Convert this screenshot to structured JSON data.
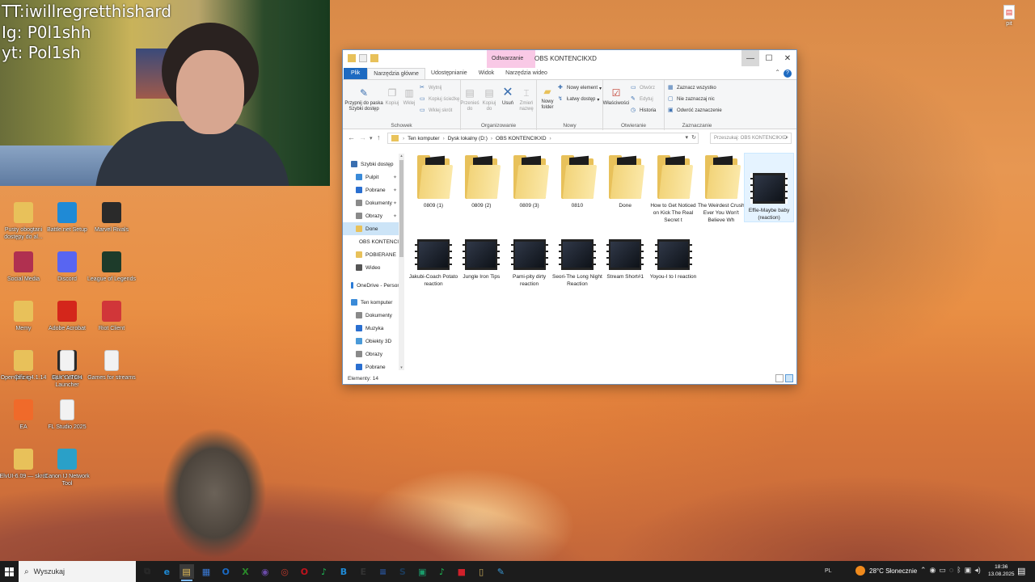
{
  "stream_overlay": {
    "lines": [
      "TT:iwillregretthishard",
      "Ig: P0l1shh",
      "yt: Pol1sh"
    ]
  },
  "desktop": {
    "top_right_icon": {
      "label": "pit",
      "icon": "pdf-file-icon"
    },
    "icons": [
      {
        "label": "Pusty obogtani dostępy do al...",
        "icon": "folder-icon",
        "color": "#e8c15a"
      },
      {
        "label": "Battle.net Setup",
        "icon": "battlenet-icon",
        "color": "#1f8ad6"
      },
      {
        "label": "Marvel Rivals",
        "icon": "marvel-rivals-icon",
        "color": "#2a2a2a"
      },
      {
        "label": "Social Media",
        "icon": "social-media-icon",
        "color": "#b03050"
      },
      {
        "label": "Discord",
        "icon": "discord-icon",
        "color": "#5865f2"
      },
      {
        "label": "League of Legends",
        "icon": "league-icon",
        "color": "#1d3b2a"
      },
      {
        "label": "Memy",
        "icon": "folder-icon",
        "color": "#e8c15a"
      },
      {
        "label": "Adobe Acrobat",
        "icon": "adobe-acrobat-icon",
        "color": "#d4261b"
      },
      {
        "label": "Riot Client",
        "icon": "riot-client-icon",
        "color": "#d13639"
      },
      {
        "label": "OpenOffice 4.1.14",
        "icon": "openoffice-icon",
        "color": "#2a8bd8"
      },
      {
        "label": "Epic Games Launcher",
        "icon": "epic-games-icon",
        "color": "#2a2a2a"
      },
      {
        "label": "Games for streams",
        "icon": "document-icon",
        "color": "#f2f2f2"
      },
      {
        "label": "ja z ig",
        "icon": "folder-icon",
        "color": "#e8c15a"
      },
      {
        "label": "GLYYYTCH",
        "icon": "document-icon",
        "color": "#f2f2f2"
      },
      {
        "label": "EA",
        "icon": "ea-icon",
        "color": "#f06a2a"
      },
      {
        "label": "FL Studio 2025",
        "icon": "document-icon",
        "color": "#f2f2f2"
      },
      {
        "label": "ElvUI-6.09 — skrót",
        "icon": "folder-icon",
        "color": "#e8c15a"
      },
      {
        "label": "Canon IJ Network Tool",
        "icon": "canon-icon",
        "color": "#2aa0c8"
      }
    ]
  },
  "explorer": {
    "title": "OBS KONTENCIKXD",
    "contextual_tab": "Odtwarzanie",
    "ribbon_tabs": [
      "Plik",
      "Narzędzia główne",
      "Udostępnianie",
      "Widok",
      "Narzędzia wideo"
    ],
    "ribbon": {
      "clipboard": {
        "group": "Schowek",
        "pin": "Przypnij do paska Szybki dostęp",
        "copy": "Kopiuj",
        "paste": "Wklej",
        "cut": "Wytnij",
        "copy_path": "Kopiuj ścieżkę",
        "paste_shortcut": "Wklej skrót"
      },
      "organize": {
        "group": "Organizowanie",
        "move_to": "Przenieś do",
        "copy_to": "Kopiuj do",
        "delete": "Usuń",
        "rename": "Zmień nazwę"
      },
      "new": {
        "group": "Nowy",
        "new_folder": "Nowy folder",
        "new_item": "Nowy element",
        "easy_access": "Łatwy dostęp"
      },
      "open": {
        "group": "Otwieranie",
        "properties": "Właściwości",
        "open": "Otwórz",
        "edit": "Edytuj",
        "history": "Historia"
      },
      "select": {
        "group": "Zaznaczanie",
        "select_all": "Zaznacz wszystko",
        "select_none": "Nie zaznaczaj nic",
        "invert": "Odwróć zaznaczenie"
      }
    },
    "address": {
      "segments": [
        "Ten komputer",
        "Dysk lokalny (D:)",
        "OBS KONTENCIKXD"
      ],
      "search_placeholder": "Przeszukaj: OBS KONTENCIKXD"
    },
    "nav_pane": [
      {
        "label": "Szybki dostęp",
        "icon": "star-icon",
        "color": "#3a6fb0",
        "pinned": false,
        "selected": false,
        "indent": 0
      },
      {
        "label": "Pulpit",
        "icon": "desktop-icon",
        "color": "#3a8ad8",
        "pinned": true,
        "selected": false,
        "indent": 1
      },
      {
        "label": "Pobrane",
        "icon": "download-icon",
        "color": "#2a6fd0",
        "pinned": true,
        "selected": false,
        "indent": 1
      },
      {
        "label": "Dokumenty",
        "icon": "documents-icon",
        "color": "#8a8a8a",
        "pinned": true,
        "selected": false,
        "indent": 1
      },
      {
        "label": "Obrazy",
        "icon": "pictures-icon",
        "color": "#8a8a8a",
        "pinned": true,
        "selected": false,
        "indent": 1
      },
      {
        "label": "Done",
        "icon": "folder-icon",
        "color": "#e8c15a",
        "pinned": false,
        "selected": true,
        "indent": 1
      },
      {
        "label": "OBS KONTENCIKXD",
        "icon": "folder-icon",
        "color": "#e8c15a",
        "pinned": false,
        "selected": false,
        "indent": 1
      },
      {
        "label": "POBIERANE",
        "icon": "folder-icon",
        "color": "#e8c15a",
        "pinned": false,
        "selected": false,
        "indent": 1
      },
      {
        "label": "Wideo",
        "icon": "video-icon",
        "color": "#555555",
        "pinned": false,
        "selected": false,
        "indent": 1
      },
      {
        "label": "OneDrive - Personal",
        "icon": "onedrive-icon",
        "color": "#2a7ad6",
        "pinned": false,
        "selected": false,
        "indent": 0
      },
      {
        "label": "Ten komputer",
        "icon": "computer-icon",
        "color": "#3a8ad8",
        "pinned": false,
        "selected": false,
        "indent": 0
      },
      {
        "label": "Dokumenty",
        "icon": "documents-icon",
        "color": "#8a8a8a",
        "pinned": false,
        "selected": false,
        "indent": 1
      },
      {
        "label": "Muzyka",
        "icon": "music-icon",
        "color": "#2a6fd0",
        "pinned": false,
        "selected": false,
        "indent": 1
      },
      {
        "label": "Obiekty 3D",
        "icon": "objects3d-icon",
        "color": "#4a9ad8",
        "pinned": false,
        "selected": false,
        "indent": 1
      },
      {
        "label": "Obrazy",
        "icon": "pictures-icon",
        "color": "#8a8a8a",
        "pinned": false,
        "selected": false,
        "indent": 1
      },
      {
        "label": "Pobrane",
        "icon": "download-icon",
        "color": "#2a6fd0",
        "pinned": false,
        "selected": false,
        "indent": 1
      }
    ],
    "files": [
      {
        "name": "0809 (1)",
        "type": "folder",
        "selected": false
      },
      {
        "name": "0809 (2)",
        "type": "folder",
        "selected": false
      },
      {
        "name": "0809 (3)",
        "type": "folder",
        "selected": false
      },
      {
        "name": "0810",
        "type": "folder",
        "selected": false
      },
      {
        "name": "Done",
        "type": "folder",
        "selected": false
      },
      {
        "name": "How to Get Noticed on Kick The Real Secret t",
        "type": "folder",
        "selected": false
      },
      {
        "name": "The Weirdest Crush Ever You Won't Believe Wh",
        "type": "folder",
        "selected": false
      },
      {
        "name": "Effie-Maybe baby (reaction)",
        "type": "video",
        "selected": true
      },
      {
        "name": "Jakubi-Coach Potato reaction",
        "type": "video",
        "selected": false
      },
      {
        "name": "Jungle Iron Tips",
        "type": "video",
        "selected": false
      },
      {
        "name": "Pami-pity dirty reaction",
        "type": "video",
        "selected": false
      },
      {
        "name": "Seori-The Long Night Reaction",
        "type": "video",
        "selected": false
      },
      {
        "name": "Stream Short#1",
        "type": "video",
        "selected": false
      },
      {
        "name": "Yoyou-I to I reaction",
        "type": "video",
        "selected": false
      }
    ],
    "status": "Elementy: 14"
  },
  "taskbar": {
    "search_placeholder": "Wyszukaj",
    "apps": [
      {
        "icon": "task-view-icon",
        "glyph": "⧉",
        "color": "#2a2a2a",
        "active": false
      },
      {
        "icon": "edge-icon",
        "glyph": "e",
        "color": "#1e8ad6",
        "active": false
      },
      {
        "icon": "file-explorer-icon",
        "glyph": "▤",
        "color": "#e8c15a",
        "active": true
      },
      {
        "icon": "store-icon",
        "glyph": "▦",
        "color": "#3a7ad6",
        "active": false
      },
      {
        "icon": "outlook-icon",
        "glyph": "O",
        "color": "#1a6ac4",
        "active": false
      },
      {
        "icon": "xbox-icon",
        "glyph": "X",
        "color": "#2a8a2a",
        "active": false
      },
      {
        "icon": "obs-icon",
        "glyph": "◉",
        "color": "#6a4aa8",
        "active": false
      },
      {
        "icon": "chrome-icon",
        "glyph": "◎",
        "color": "#c0392b",
        "active": false
      },
      {
        "icon": "opera-icon",
        "glyph": "O",
        "color": "#c1121c",
        "active": false
      },
      {
        "icon": "spotify-icon",
        "glyph": "♪",
        "color": "#1db954",
        "active": false
      },
      {
        "icon": "battlenet-icon",
        "glyph": "B",
        "color": "#1f8ad6",
        "active": false
      },
      {
        "icon": "epic-games-icon",
        "glyph": "E",
        "color": "#333333",
        "active": false
      },
      {
        "icon": "notepad-icon",
        "glyph": "≡",
        "color": "#2a5aa8",
        "active": false
      },
      {
        "icon": "steam-icon",
        "glyph": "S",
        "color": "#1b3a5a",
        "active": false
      },
      {
        "icon": "xbox-app-icon",
        "glyph": "▣",
        "color": "#1a9a6a",
        "active": false
      },
      {
        "icon": "spotify-icon",
        "glyph": "♪",
        "color": "#1db954",
        "active": false
      },
      {
        "icon": "red-app-icon",
        "glyph": "■",
        "color": "#d0202a",
        "active": false
      },
      {
        "icon": "file-icon",
        "glyph": "▯",
        "color": "#c8a85a",
        "active": false
      },
      {
        "icon": "paint-icon",
        "glyph": "✎",
        "color": "#3a9ad8",
        "active": false
      }
    ],
    "language": "PL",
    "weather": "28°C  Słonecznie",
    "time": "18:36",
    "date": "13.08.2025"
  }
}
